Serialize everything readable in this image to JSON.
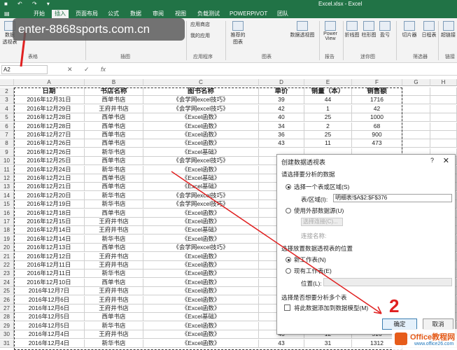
{
  "window": {
    "quick_access": "■ ↶ ↷ ▾",
    "title": "Excel.xlsx - Excel"
  },
  "tabs": [
    {
      "label": "开始",
      "active": false
    },
    {
      "label": "插入",
      "active": true
    },
    {
      "label": "页面布局",
      "active": false
    },
    {
      "label": "公式",
      "active": false
    },
    {
      "label": "数据",
      "active": false
    },
    {
      "label": "审阅",
      "active": false
    },
    {
      "label": "视图",
      "active": false
    },
    {
      "label": "负载测试",
      "active": false
    },
    {
      "label": "POWERPIVOT",
      "active": false
    },
    {
      "label": "团队",
      "active": false
    }
  ],
  "ribbon": {
    "pivot_button": "数据\n透视表",
    "recommended_pivot": "推荐的数据透视表",
    "app_store": "应用商店",
    "my_apps": "我的应用",
    "recommended_charts": "推荐的\n图表",
    "pivot_chart": "数据透视图",
    "power_view": "Power\nView",
    "groups": [
      "表格",
      "插图",
      "应用程序",
      "图表",
      "报告",
      "迷你图",
      "筛选器",
      "链接"
    ],
    "sparklines": [
      "折线图",
      "柱形图",
      "盈亏"
    ],
    "slicer": "切片器",
    "timeline": "日程表",
    "hyperlink": "超链接"
  },
  "watermark": "enter-8868sports.com.cn",
  "formula_bar": {
    "name_box": "A2",
    "cancel": "✕",
    "enter": "✓",
    "fx": "fx"
  },
  "columns": [
    "A",
    "B",
    "C",
    "D",
    "E",
    "F",
    "G",
    "H"
  ],
  "header_row": {
    "row": "2",
    "cells": [
      "日期",
      "书店名称",
      "图书名称",
      "单价",
      "销量（本）",
      "销售额"
    ]
  },
  "rows": [
    {
      "n": "3",
      "cells": [
        "2016年12月31日",
        "西单书店",
        "《会学网excel技巧》",
        "39",
        "44",
        "1716"
      ]
    },
    {
      "n": "4",
      "cells": [
        "2016年12月29日",
        "王府井书店",
        "《会学网excel技巧》",
        "42",
        "1",
        "42"
      ]
    },
    {
      "n": "5",
      "cells": [
        "2016年12月28日",
        "西单书店",
        "《Excel函数》",
        "40",
        "25",
        "1000"
      ]
    },
    {
      "n": "6",
      "cells": [
        "2016年12月28日",
        "西单书店",
        "《Excel函数》",
        "34",
        "2",
        "68"
      ]
    },
    {
      "n": "7",
      "cells": [
        "2016年12月27日",
        "西单书店",
        "《Excel函数》",
        "36",
        "25",
        "900"
      ]
    },
    {
      "n": "8",
      "cells": [
        "2016年12月26日",
        "西单书店",
        "《Excel函数》",
        "43",
        "11",
        "473"
      ]
    },
    {
      "n": "9",
      "cells": [
        "2016年12月26日",
        "新华书店",
        "《Excel基础》",
        "",
        "",
        ""
      ]
    },
    {
      "n": "10",
      "cells": [
        "2016年12月25日",
        "西单书店",
        "《会学网excel技巧》",
        "",
        "",
        ""
      ]
    },
    {
      "n": "11",
      "cells": [
        "2016年12月24日",
        "新华书店",
        "《Excel函数》",
        "",
        "",
        ""
      ]
    },
    {
      "n": "12",
      "cells": [
        "2016年12月21日",
        "西单书店",
        "《Excel基础》",
        "",
        "",
        ""
      ]
    },
    {
      "n": "13",
      "cells": [
        "2016年12月21日",
        "西单书店",
        "《Excel基础》",
        "",
        "",
        ""
      ]
    },
    {
      "n": "14",
      "cells": [
        "2016年12月20日",
        "新华书店",
        "《会学网excel技巧》",
        "",
        "",
        ""
      ]
    },
    {
      "n": "15",
      "cells": [
        "2016年12月19日",
        "新华书店",
        "《会学网excel技巧》",
        "",
        "",
        ""
      ]
    },
    {
      "n": "16",
      "cells": [
        "2016年12月18日",
        "西单书店",
        "《Excel函数》",
        "",
        "",
        ""
      ]
    },
    {
      "n": "17",
      "cells": [
        "2016年12月15日",
        "王府井书店",
        "《Excel函数》",
        "",
        "",
        ""
      ]
    },
    {
      "n": "18",
      "cells": [
        "2016年12月14日",
        "王府井书店",
        "《Excel基础》",
        "",
        "",
        ""
      ]
    },
    {
      "n": "19",
      "cells": [
        "2016年12月14日",
        "新华书店",
        "《Excel函数》",
        "",
        "",
        ""
      ]
    },
    {
      "n": "20",
      "cells": [
        "2016年12月13日",
        "西单书店",
        "《会学网excel技巧》",
        "",
        "",
        ""
      ]
    },
    {
      "n": "21",
      "cells": [
        "2016年12月12日",
        "王府井书店",
        "《Excel函数》",
        "",
        "",
        ""
      ]
    },
    {
      "n": "22",
      "cells": [
        "2016年12月11日",
        "王府井书店",
        "《Excel函数》",
        "",
        "",
        ""
      ]
    },
    {
      "n": "23",
      "cells": [
        "2016年12月11日",
        "新华书店",
        "《Excel函数》",
        "",
        "",
        ""
      ]
    },
    {
      "n": "24",
      "cells": [
        "2016年12月10日",
        "西单书店",
        "《Excel函数》",
        "",
        "",
        ""
      ]
    },
    {
      "n": "25",
      "cells": [
        "2016年12月7日",
        "王府井书店",
        "《Excel函数》",
        "",
        "",
        ""
      ]
    },
    {
      "n": "26",
      "cells": [
        "2016年12月6日",
        "王府井书店",
        "《Excel函数》",
        "",
        "",
        ""
      ]
    },
    {
      "n": "27",
      "cells": [
        "2016年12月6日",
        "王府井书店",
        "《Excel函数》",
        "",
        "",
        ""
      ]
    },
    {
      "n": "28",
      "cells": [
        "2016年12月5日",
        "西单书店",
        "《Excel基础》",
        "",
        "",
        ""
      ]
    },
    {
      "n": "29",
      "cells": [
        "2016年12月5日",
        "新华书店",
        "《Excel函数》",
        "",
        "",
        ""
      ]
    },
    {
      "n": "30",
      "cells": [
        "2016年12月4日",
        "王府井书店",
        "《Excel函数》",
        "43",
        "12",
        "516"
      ]
    },
    {
      "n": "31",
      "cells": [
        "2016年12月4日",
        "新华书店",
        "《Excel函数》",
        "43",
        "31",
        "1312"
      ]
    }
  ],
  "dialog": {
    "title": "创建数据透视表",
    "help": "?",
    "close": "✕",
    "section1": "请选择要分析的数据",
    "opt_select_range": "选择一个表或区域(S)",
    "range_label": "表/区域(I):",
    "range_value": "明细表!$A$2:$F$376",
    "opt_external": "使用外部数据源(U)",
    "choose_connection": "选择连接(C)...",
    "connection_name": "连接名称:",
    "section2": "选择放置数据透视表的位置",
    "opt_new_sheet": "新工作表(N)",
    "opt_existing_sheet": "现有工作表(E)",
    "location_label": "位置(L):",
    "section3": "选择是否想要分析多个表",
    "add_to_model": "将此数据添加到数据模型(M)",
    "ok": "确定",
    "cancel": "取消"
  },
  "annotations": {
    "step2": "2"
  },
  "office_logo": {
    "text": "Office教程网",
    "url": "www.office26.com"
  },
  "colors": {
    "excel_green": "#217346",
    "annotation_red": "#e02020",
    "office_orange": "#e65c1a"
  }
}
